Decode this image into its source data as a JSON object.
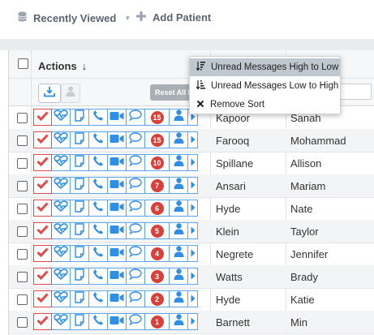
{
  "toolbar": {
    "recently_viewed": "Recently Viewed",
    "add_patient": "Add Patient"
  },
  "grid": {
    "actions_header": "Actions",
    "actions_sort_arrow": "↓",
    "reset_button": "Reset All Fi"
  },
  "sort_menu": {
    "items": [
      {
        "label": "Unread Messages High to Low",
        "icon": "sort-desc-icon",
        "active": true
      },
      {
        "label": "Unread Messages Low to High",
        "icon": "sort-asc-icon",
        "active": false
      },
      {
        "label": "Remove Sort",
        "icon": "close-icon",
        "active": false
      }
    ]
  },
  "rows": [
    {
      "last": "Kapoor",
      "first": "Sanah",
      "unread": "15"
    },
    {
      "last": "Farooq",
      "first": "Mohammad",
      "unread": "15"
    },
    {
      "last": "Spillane",
      "first": "Allison",
      "unread": "10"
    },
    {
      "last": "Ansari",
      "first": "Mariam",
      "unread": "7"
    },
    {
      "last": "Hyde",
      "first": "Nate",
      "unread": "6"
    },
    {
      "last": "Klein",
      "first": "Taylor",
      "unread": "5"
    },
    {
      "last": "Negrete",
      "first": "Jennifer",
      "unread": "4"
    },
    {
      "last": "Watts",
      "first": "Brady",
      "unread": "3"
    },
    {
      "last": "Hyde",
      "first": "Katie",
      "unread": "2"
    },
    {
      "last": "Barnett",
      "first": "Min",
      "unread": "1"
    }
  ],
  "colors": {
    "accent_blue": "#2f8fe6",
    "check_red": "#e24a4a",
    "badge_red": "#d9403a",
    "menu_active": "#bfc8cf"
  }
}
